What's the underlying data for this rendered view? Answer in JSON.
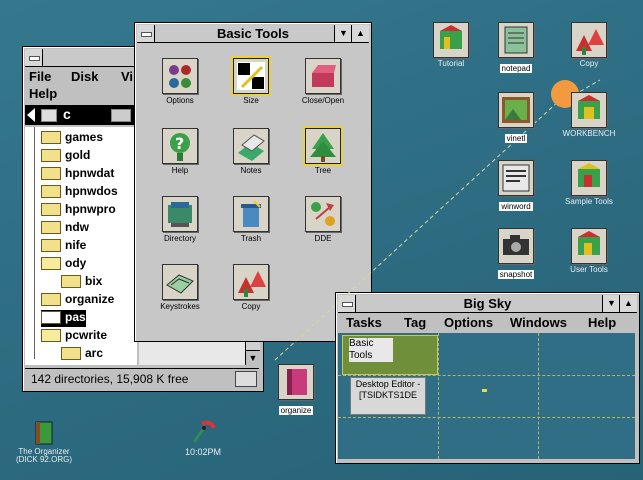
{
  "file_window": {
    "title": "C",
    "menu": [
      "File",
      "Disk",
      "Vi",
      "Help"
    ],
    "drive": "c",
    "folders": [
      "games",
      "gold",
      "hpnwdat",
      "hpnwdos",
      "hpnwpro",
      "ndw",
      "nife",
      "ody",
      "bix",
      "organize",
      "pas",
      "pcwrite",
      "arc"
    ],
    "selected": "pas",
    "status": "142 directories, 15,908 K free"
  },
  "basic_tools": {
    "title": "Basic Tools",
    "tools": [
      {
        "label": "Options",
        "icon": "options-icon"
      },
      {
        "label": "Size",
        "icon": "size-icon"
      },
      {
        "label": "Close/Open",
        "icon": "close-open-icon"
      },
      {
        "label": "Help",
        "icon": "help-icon"
      },
      {
        "label": "Notes",
        "icon": "notes-icon"
      },
      {
        "label": "Tree",
        "icon": "tree-icon"
      },
      {
        "label": "Directory",
        "icon": "directory-icon"
      },
      {
        "label": "Trash",
        "icon": "trash-icon"
      },
      {
        "label": "DDE",
        "icon": "dde-icon"
      },
      {
        "label": "Keystrokes",
        "icon": "keystrokes-icon"
      },
      {
        "label": "Copy",
        "icon": "copy-icon"
      }
    ]
  },
  "big_sky": {
    "title": "Big Sky",
    "menu": [
      "Tasks",
      "Tag",
      "Options",
      "Windows",
      "Help"
    ],
    "thumb1": "Basic Tools",
    "thumb2": "Desktop Editor - [TSIDKTS1DE"
  },
  "desktop_icons": [
    {
      "label": "Tutorial",
      "icon": "tutorial-icon"
    },
    {
      "label": "notepad",
      "icon": "notepad-icon"
    },
    {
      "label": "Copy",
      "icon": "copy-icon"
    },
    {
      "label": "vinetl",
      "icon": "picture-icon"
    },
    {
      "label": "WORKBENCH",
      "icon": "workbench-icon"
    },
    {
      "label": "winword",
      "icon": "winword-icon"
    },
    {
      "label": "Sample Tools",
      "icon": "sample-tools-icon"
    },
    {
      "label": "snapshot",
      "icon": "camera-icon"
    },
    {
      "label": "User Tools",
      "icon": "user-tools-icon"
    },
    {
      "label": "organize",
      "icon": "organize-icon"
    }
  ],
  "bottom": {
    "organizer_label1": "The Organizer",
    "organizer_label2": "(DICK 92.ORG)",
    "clock": "10:02PM"
  },
  "colors": {
    "desktop": "#2e6f86",
    "window": "#c0c0c0",
    "folder": "#f2e08a"
  }
}
